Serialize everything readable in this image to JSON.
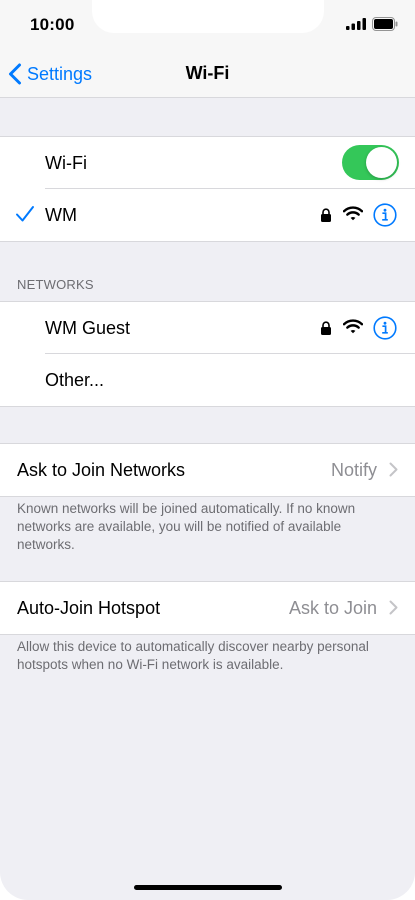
{
  "status_bar": {
    "time": "10:00"
  },
  "nav": {
    "back_label": "Settings",
    "title": "Wi-Fi"
  },
  "wifi_group": {
    "toggle_label": "Wi-Fi",
    "toggle_on": true,
    "connected_network": "WM"
  },
  "networks_section": {
    "header": "NETWORKS",
    "items": [
      {
        "name": "WM Guest",
        "secured": true
      },
      {
        "name": "Other..."
      }
    ]
  },
  "ask_to_join": {
    "label": "Ask to Join Networks",
    "value": "Notify",
    "footer": "Known networks will be joined automatically. If no known networks are available, you will be notified of available networks."
  },
  "auto_join": {
    "label": "Auto-Join Hotspot",
    "value": "Ask to Join",
    "footer": "Allow this device to automatically discover nearby personal hotspots when no Wi-Fi network is available."
  },
  "colors": {
    "accent": "#007aff",
    "toggle_on": "#34c759",
    "background": "#efeff4"
  }
}
